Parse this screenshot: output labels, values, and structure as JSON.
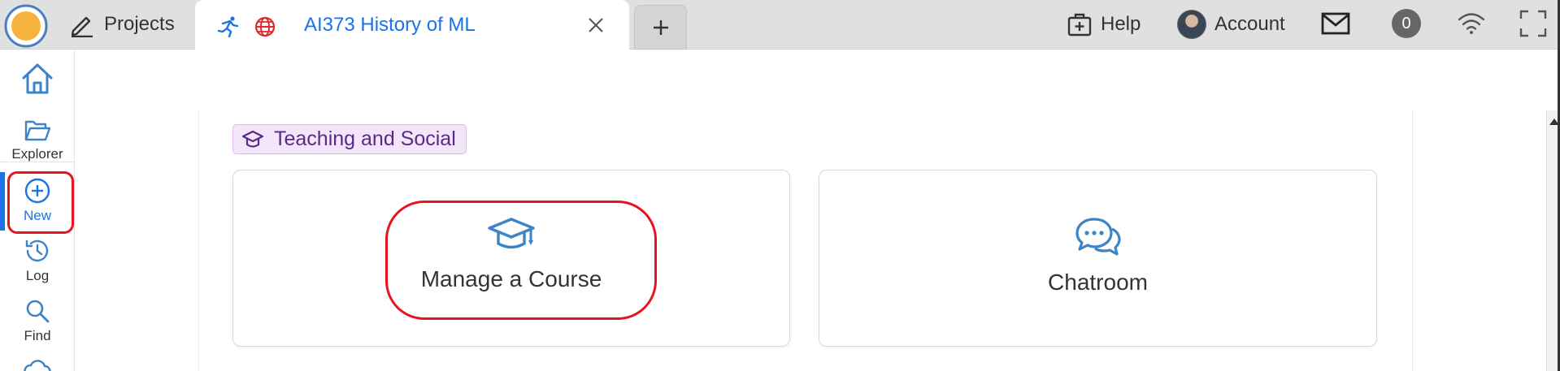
{
  "topbar": {
    "projects_label": "Projects",
    "tab_title": "AI373 History of ML",
    "help_label": "Help",
    "account_label": "Account",
    "notification_count": "0"
  },
  "rail": {
    "items": [
      {
        "label": "Explorer",
        "icon": "folder-open-icon"
      },
      {
        "label": "New",
        "icon": "plus-circle-icon",
        "active": true
      },
      {
        "label": "Log",
        "icon": "history-icon"
      },
      {
        "label": "Find",
        "icon": "search-icon"
      }
    ]
  },
  "main": {
    "section_label": "Teaching and Social",
    "cards": [
      {
        "label": "Manage a Course",
        "icon": "graduation-cap-icon"
      },
      {
        "label": "Chatroom",
        "icon": "chat-bubbles-icon"
      }
    ]
  },
  "colors": {
    "accent": "#1a73e8",
    "icon_blue": "#3d84c6",
    "highlight_red": "#e4151f",
    "tag_bg": "#f3e6fb",
    "tag_text": "#5b2a86"
  }
}
